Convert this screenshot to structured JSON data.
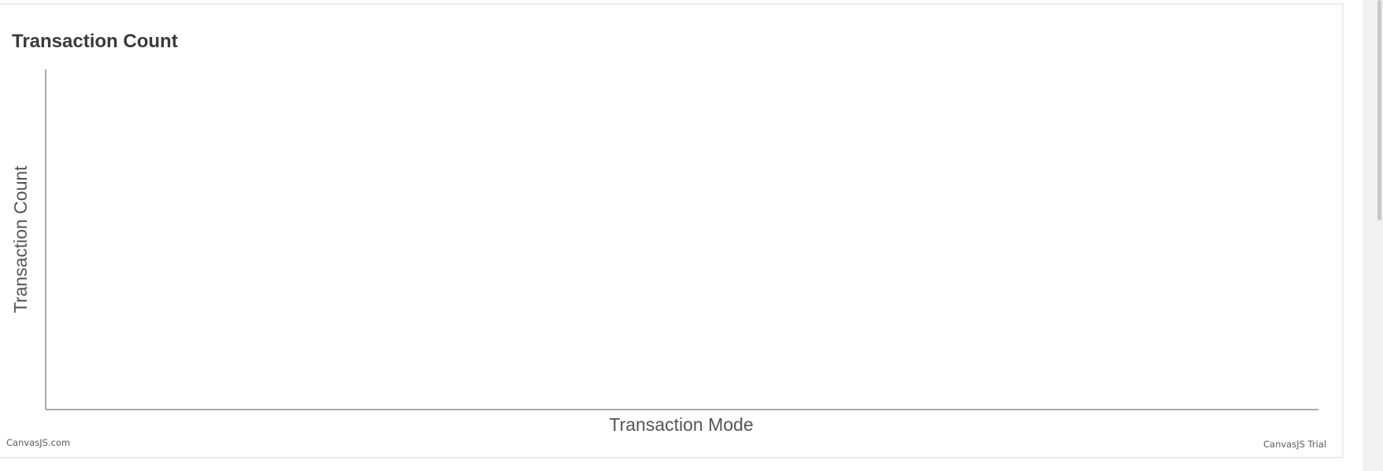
{
  "chart_data": {
    "type": "bar",
    "title": "Transaction Count",
    "xlabel": "Transaction Mode",
    "ylabel": "Transaction Count",
    "categories": [],
    "values": [],
    "grid": false,
    "legend": "none"
  },
  "credits": {
    "left": "CanvasJS.com",
    "right": "CanvasJS Trial"
  },
  "colors": {
    "axis": "#8f8f8f",
    "title": "#3a3a3a",
    "label": "#555555",
    "card_border": "#ececec",
    "scrollbar_track": "#f1f1f1",
    "scrollbar_thumb": "#c9c9c9"
  }
}
